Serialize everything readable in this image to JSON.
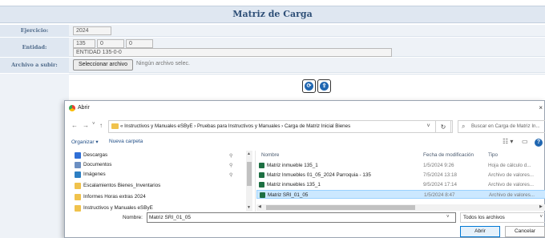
{
  "form": {
    "title": "Matriz de Carga",
    "ejercicio_label": "Ejercicio:",
    "ejercicio_value": "2024",
    "entidad_label": "Entidad:",
    "entidad_codes": [
      "135",
      "0",
      "0"
    ],
    "entidad_name": "ENTIDAD 135-0-0",
    "archivo_label": "Archivo a subir:",
    "file_button": "Seleccionar archivo",
    "file_none": "Ningún archivo selec.",
    "action_icons": [
      "refresh-icon",
      "upload-icon"
    ]
  },
  "dialog": {
    "title": "Abrir",
    "close": "×",
    "nav": {
      "back": "←",
      "forward": "→",
      "dropdown": "˅",
      "up": "↑"
    },
    "address": "«  Instructivos y Manuales eSByE  ›  Pruebas para Instructivos y Manuales  ›  Carga de Matriz Inicial Bienes",
    "address_chevron": "˅",
    "refresh": "↻",
    "search_placeholder": "Buscar en Carga de Matriz In...",
    "toolbar": {
      "organize": "Organizar ▾",
      "new_folder": "Nueva carpeta",
      "view_menu": "☷ ▾",
      "pane": "▭",
      "help": "?"
    },
    "tree": [
      {
        "label": "Descargas",
        "icon": "download-icon",
        "color": "#2f6fd6",
        "pinned": true
      },
      {
        "label": "Documentos",
        "icon": "document-icon",
        "color": "#6b8fc2",
        "pinned": true
      },
      {
        "label": "Imágenes",
        "icon": "image-icon",
        "color": "#2d7fc3",
        "pinned": true
      },
      {
        "label": "Escalamientos Bienes_Inventarios",
        "icon": "folder-icon",
        "color": "#f0c24c",
        "pinned": false
      },
      {
        "label": "Informes Horas extras 2024",
        "icon": "folder-icon",
        "color": "#f0c24c",
        "pinned": false
      },
      {
        "label": "Instructivos y Manuales eSByE",
        "icon": "folder-icon",
        "color": "#f0c24c",
        "pinned": false
      }
    ],
    "pin_glyph": "⚲",
    "columns": [
      "Nombre",
      "Fecha de modificación",
      "Tipo"
    ],
    "sort_glyph": "^",
    "files": [
      {
        "name": "Matriz inmueble 135_1",
        "date": "1/5/2024 9:26",
        "type": "Hoja de cálculo d...",
        "selected": false
      },
      {
        "name": "Matriz Inmuebles 01_05_2024 Parroquia - 135",
        "date": "7/5/2024 13:18",
        "type": "Archivo de valores...",
        "selected": false
      },
      {
        "name": "Matriz inmuebles 135_1",
        "date": "9/5/2024 17:14",
        "type": "Archivo de valores...",
        "selected": false
      },
      {
        "name": "Matriz SRI_01_05",
        "date": "1/5/2024 8:47",
        "type": "Archivo de valores...",
        "selected": true
      }
    ],
    "filename_label": "Nombre:",
    "filename_value": "Matriz SRI_01_05",
    "filetype": "Todos los archivos",
    "open_button": "Abrir",
    "cancel_button": "Cancelar"
  }
}
